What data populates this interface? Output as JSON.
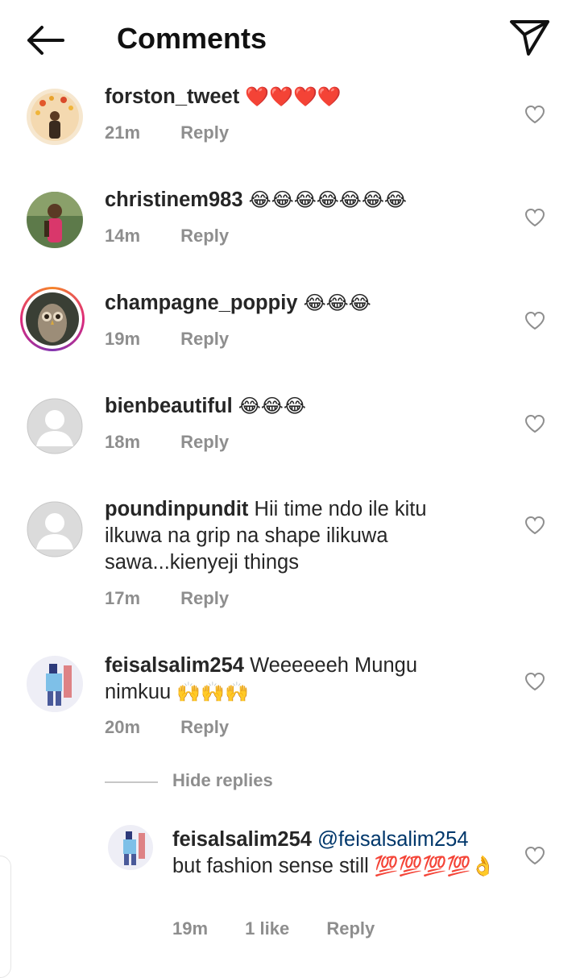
{
  "header": {
    "title": "Comments"
  },
  "comments": [
    {
      "username": "forston_tweet",
      "text": "",
      "emoji": "❤️❤️❤️❤️",
      "time": "21m",
      "reply_label": "Reply"
    },
    {
      "username": "christinem983",
      "text": "",
      "emoji": "😂😂😂😂😂😂😂",
      "time": "14m",
      "reply_label": "Reply"
    },
    {
      "username": "champagne_poppiy",
      "text": "",
      "emoji": "😂😂😂",
      "time": "19m",
      "reply_label": "Reply"
    },
    {
      "username": "bienbeautiful",
      "text": "",
      "emoji": "😂😂😂",
      "time": "18m",
      "reply_label": "Reply"
    },
    {
      "username": "poundinpundit",
      "text": "Hii time ndo ile kitu ilkuwa na grip na shape ilikuwa sawa...kienyeji things",
      "emoji": "",
      "time": "17m",
      "reply_label": "Reply"
    },
    {
      "username": "feisalsalim254",
      "text": "Weeeeeeh Mungu nimkuu",
      "emoji": "🙌🙌🙌",
      "time": "20m",
      "reply_label": "Reply"
    }
  ],
  "hide_replies_label": "Hide replies",
  "reply": {
    "username": "feisalsalim254",
    "mention": "@feisalsalim254",
    "text": "but fashion sense still",
    "emoji": "💯💯💯💯👌",
    "time": "19m",
    "likes": "1 like",
    "reply_label": "Reply"
  },
  "colors": {
    "text": "#262626",
    "meta": "#8e8e8e",
    "mention": "#00376b",
    "heart_outline": "#8e8e8e",
    "story_ring": "#dd2a7b"
  }
}
